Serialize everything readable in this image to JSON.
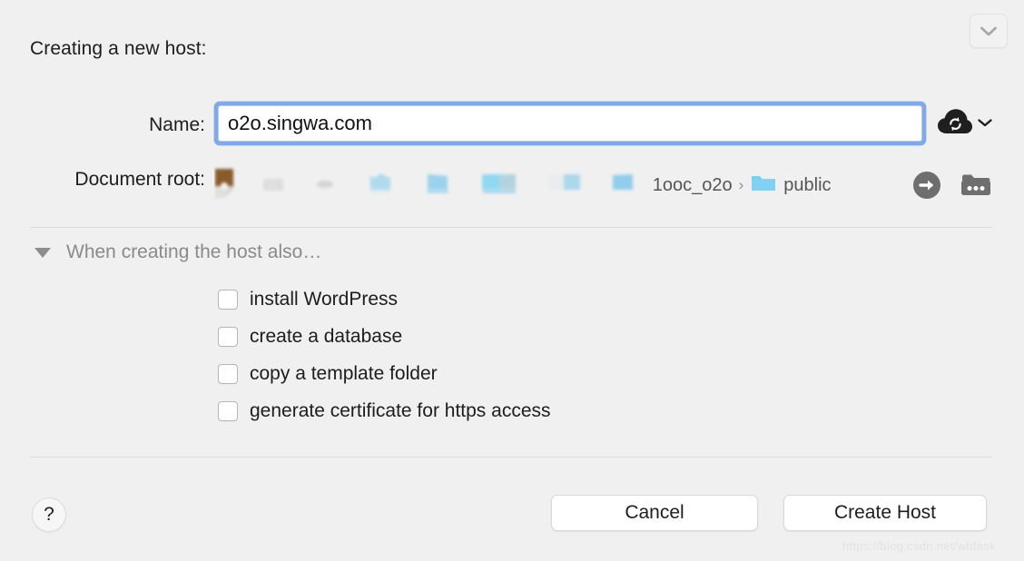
{
  "dialog": {
    "heading": "Creating a new host:",
    "collapse_icon": "chevron-down-icon"
  },
  "form": {
    "name": {
      "label": "Name:",
      "value": "o2o.singwa.com",
      "placeholder": "",
      "sync_icon": "cloud-sync-icon",
      "sync_dropdown_icon": "chevron-down-icon"
    },
    "document_root": {
      "label": "Document root:",
      "crumbs": [
        {
          "icon": "folder-icon",
          "text": "1ooc_o2o"
        },
        {
          "icon": "folder-icon",
          "text": "public"
        }
      ],
      "separator": "›",
      "ghost_count": 8,
      "reveal_icon": "arrow-right-circle-icon",
      "choose_icon": "folder-ellipsis-icon"
    }
  },
  "disclosure": {
    "triangle_icon": "triangle-down-icon",
    "label": "When creating the host also…",
    "expanded": true
  },
  "options": [
    {
      "label": "install WordPress",
      "checked": false
    },
    {
      "label": "create a database",
      "checked": false
    },
    {
      "label": "copy a template folder",
      "checked": false
    },
    {
      "label": "generate certificate for https access",
      "checked": false
    }
  ],
  "footer": {
    "help_label": "?",
    "cancel_label": "Cancel",
    "create_label": "Create Host"
  },
  "watermark": "https://blog.csdn.net/wtdask",
  "colors": {
    "background": "#f0f0f0",
    "focus_ring": "#7fa9e8",
    "folder_blue": "#7fc8ec",
    "text_primary": "#1d1d1d",
    "text_muted": "#8a8a8a",
    "divider": "#dcdcdc"
  }
}
